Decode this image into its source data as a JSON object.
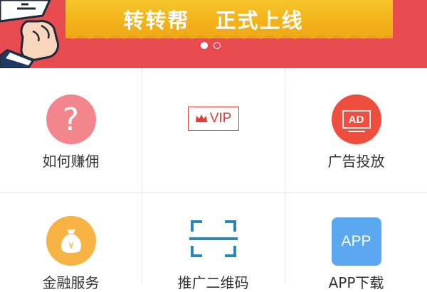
{
  "banner": {
    "text": "转转帮   正式上线",
    "carousel": {
      "count": 2,
      "active_index": 0
    }
  },
  "grid": {
    "items": [
      {
        "label": "如何赚佣",
        "icon": "question-icon",
        "glyph": "?",
        "color": "#f2868c"
      },
      {
        "label": "",
        "icon": "vip-crown-icon",
        "glyph": "VIP",
        "color": "#e23b35"
      },
      {
        "label": "广告投放",
        "icon": "ad-icon",
        "glyph": "AD",
        "color": "#ef4e3f"
      },
      {
        "label": "金融服务",
        "icon": "money-bag-icon",
        "glyph": "¥",
        "color": "#f7b343"
      },
      {
        "label": "推广二维码",
        "icon": "qr-scan-icon",
        "glyph": "",
        "color": "#2b86b9"
      },
      {
        "label": "APP下载",
        "icon": "app-icon",
        "glyph": "APP",
        "color": "#5ba8f0"
      }
    ]
  }
}
